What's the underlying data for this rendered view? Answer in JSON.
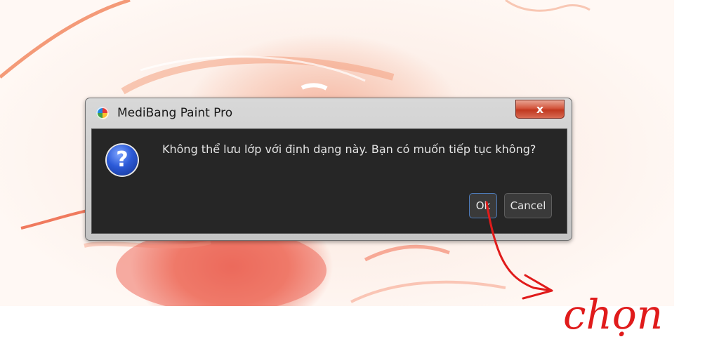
{
  "dialog": {
    "title": "MediBang Paint Pro",
    "close_label": "x",
    "message": "Không thể lưu lớp với định dạng này. Bạn có muốn tiếp tục không?",
    "ok_label": "Ok",
    "cancel_label": "Cancel",
    "question_symbol": "?"
  },
  "icons": {
    "app": "medibang-app-icon",
    "message": "question-icon"
  },
  "annotation": {
    "text": "chọn",
    "color": "#e01b1b"
  }
}
